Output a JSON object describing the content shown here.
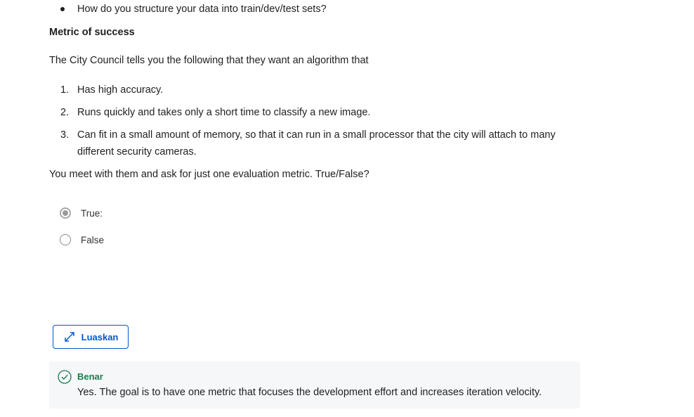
{
  "prev_bullet": "How do you structure your data into train/dev/test sets?",
  "section_heading": "Metric of success",
  "intro_text": "The City Council tells you the following that they want an algorithm that",
  "requirements": [
    {
      "num": "1.",
      "text": "Has high accuracy."
    },
    {
      "num": "2.",
      "text": "Runs quickly and takes only a short time to classify a new image."
    },
    {
      "num": "3.",
      "text": "Can fit in a small amount of memory, so that it can run in a small processor that the city will attach to many different security cameras."
    }
  ],
  "question": "You meet with them and ask for just one evaluation metric. True/False?",
  "options": [
    {
      "label": "True:",
      "selected": true
    },
    {
      "label": "False",
      "selected": false
    }
  ],
  "expand_button": {
    "label": "Luaskan",
    "icon": "expand-arrows-icon"
  },
  "feedback": {
    "status": "Benar",
    "icon": "check-circle-icon",
    "message": "Yes. The goal is to have one metric that focuses the development effort and increases iteration velocity."
  },
  "colors": {
    "accent": "#0056d2",
    "correct": "#1d7c50",
    "feedback_bg": "#f5f7f8"
  }
}
